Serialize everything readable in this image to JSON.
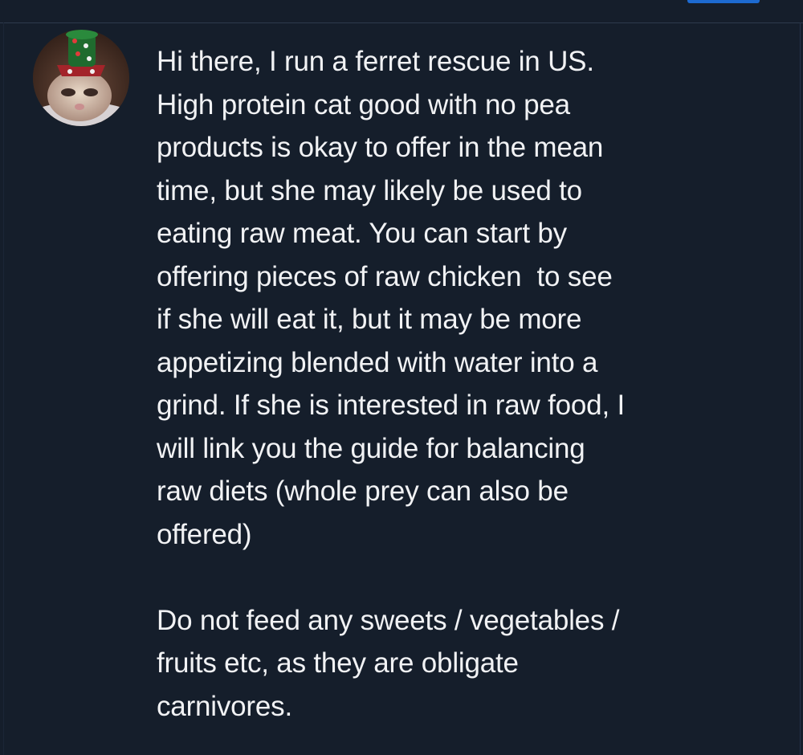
{
  "comment": {
    "avatar": "ferret-avatar",
    "paragraphs": [
      "Hi there, I run a ferret rescue in US.\nHigh protein cat good with no pea\nproducts is okay to offer in the mean\ntime, but she may likely be used to\neating raw meat. You can start by\noffering pieces of raw chicken  to see\nif she will eat it, but it may be more\nappetizing blended with water into a\ngrind. If she is interested in raw food, I\nwill link you the guide for balancing\nraw diets (whole prey can also be\noffered)",
      "Do not feed any sweets / vegetables /\nfruits etc, as they are obligate\ncarnivores."
    ]
  },
  "colors": {
    "background": "#151e2b",
    "text": "#f1f2f4",
    "border": "#2e3a4d",
    "accent": "#1d6ad0"
  }
}
